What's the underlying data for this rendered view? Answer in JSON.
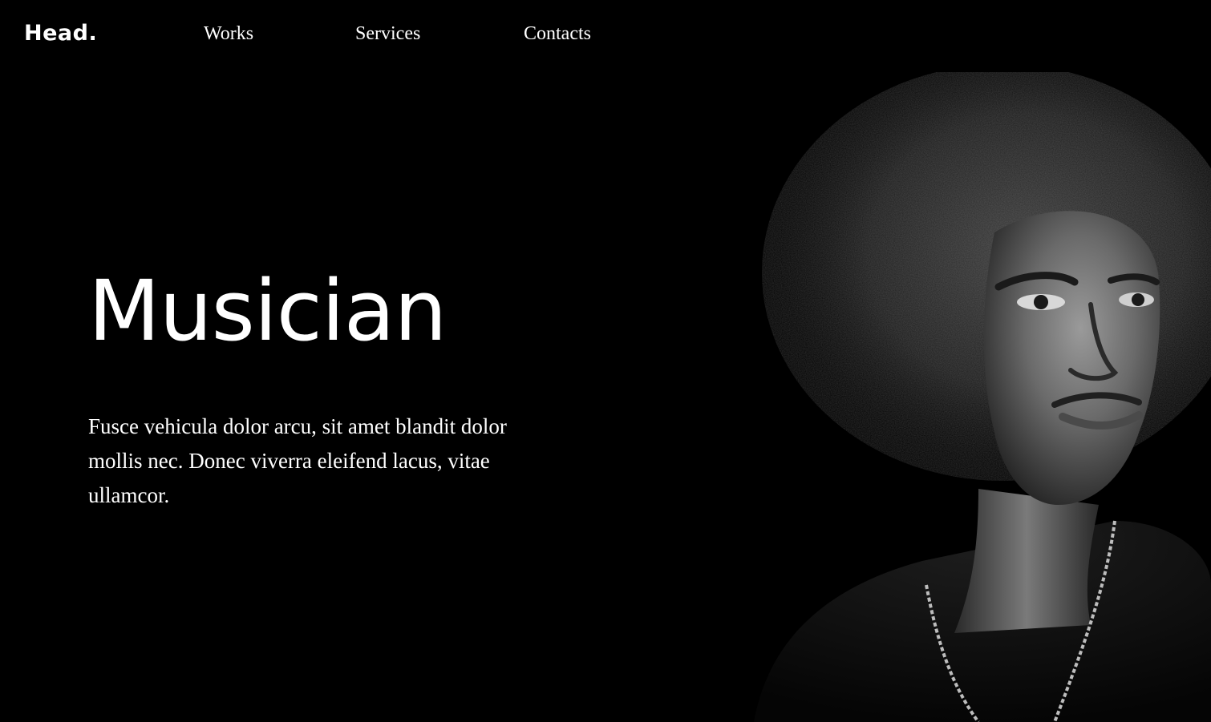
{
  "header": {
    "logo": "Head.",
    "nav": [
      {
        "label": "Works"
      },
      {
        "label": "Services"
      },
      {
        "label": "Contacts"
      }
    ]
  },
  "hero": {
    "title": "Musician",
    "description": "Fusce vehicula dolor arcu, sit amet blandit dolor mollis nec. Donec viverra eleifend lacus, vitae ullamcor.",
    "image": "black-and-white portrait of a man with curly hair"
  },
  "colors": {
    "background": "#000000",
    "text": "#ffffff"
  }
}
